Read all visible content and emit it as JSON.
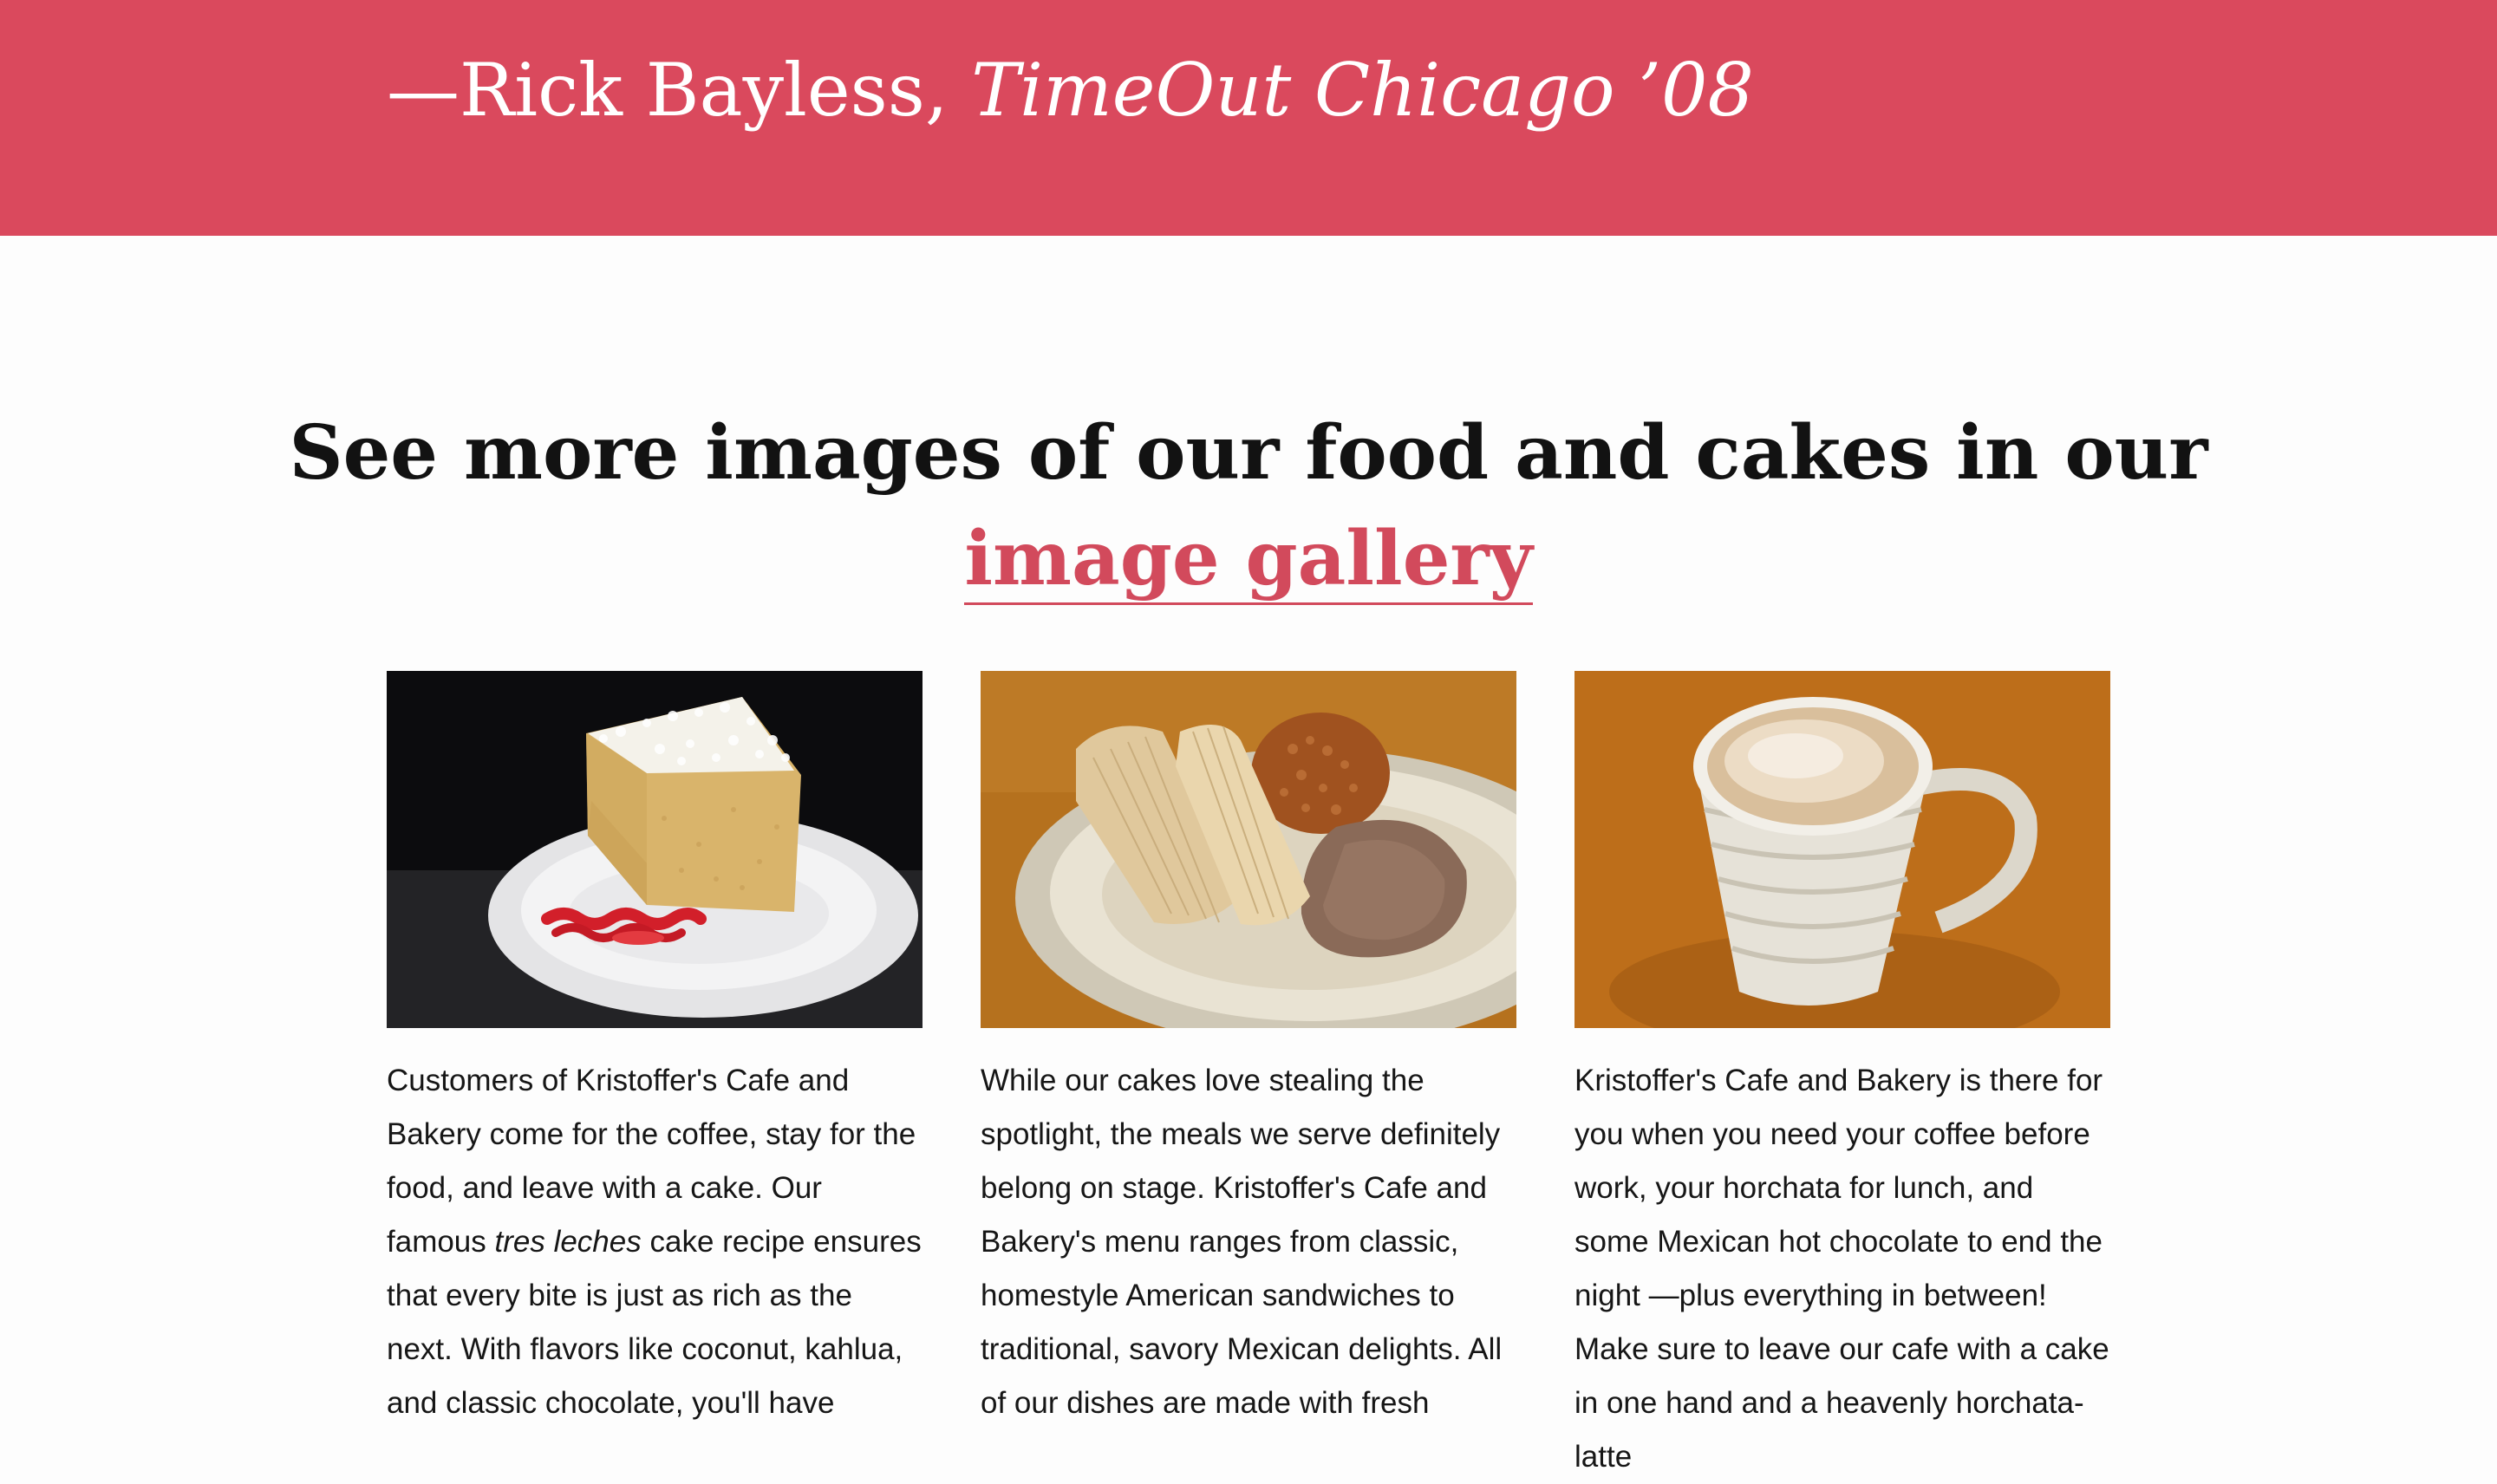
{
  "banner": {
    "attribution": "—Rick Bayless, ",
    "publication": "TimeOut Chicago ’08",
    "color": "#da495d"
  },
  "gallery_prompt": {
    "text": "See more images of our food and cakes in our",
    "link_label": "image gallery",
    "link_color": "#d24a5c"
  },
  "columns": [
    {
      "image_subject": "Slice of tres leches cake with coconut on a white plate with red sauce",
      "text_before": "Customers of Kristoffer's Cafe and Bakery come for the coffee, stay for the food, and leave with a cake. Our famous ",
      "text_em": "tres leches",
      "text_after": " cake recipe ensures that every bite is just as rich as the next. With flavors like coconut, kahlua, and classic chocolate, you'll have"
    },
    {
      "image_subject": "Plate of tamales with Mexican rice and refried beans",
      "text": "While our cakes love stealing the spotlight, the meals we serve definitely belong on stage. Kristoffer's Cafe and Bakery's menu ranges from classic, homestyle American sandwiches to traditional, savory Mexican delights. All of our dishes are made with fresh"
    },
    {
      "image_subject": "Cup of latte with foam in a white ribbed mug",
      "text": "Kristoffer's Cafe and Bakery is there for you when you need your coffee before work, your horchata for lunch, and some Mexican hot chocolate to end the night —plus everything in between! Make sure to leave our cafe with a cake in one hand and a heavenly horchata-latte"
    }
  ]
}
